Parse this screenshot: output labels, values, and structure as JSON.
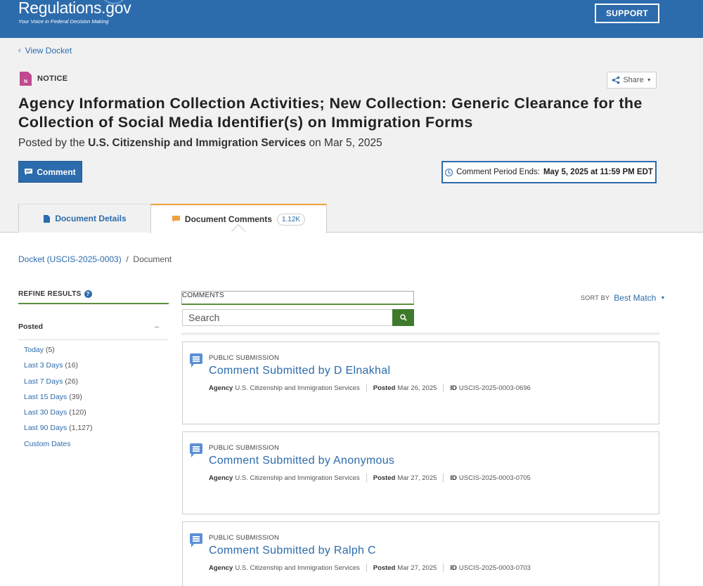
{
  "header": {
    "logo": "Regulations.gov",
    "tagline": "Your Voice in Federal Decision Making",
    "support_label": "SUPPORT"
  },
  "hero": {
    "back_link": "View Docket",
    "doc_type": "NOTICE",
    "doc_icon_letter": "N",
    "share_label": "Share",
    "title": "Agency Information Collection Activities; New Collection: Generic Clearance for the Collection of Social Media Identifier(s) on Immigration Forms",
    "posted_prefix": "Posted by the",
    "posted_agency": "U.S. Citizenship and Immigration Services",
    "posted_suffix": "on Mar 5, 2025",
    "comment_button": "Comment",
    "period_label": "Comment Period Ends:",
    "period_value": "May 5, 2025 at 11:59 PM EDT"
  },
  "tabs": {
    "details": "Document Details",
    "comments": "Document Comments",
    "comments_count": "1.12K"
  },
  "breadcrumb": {
    "docket": "Docket (USCIS-2025-0003)",
    "separator": "/",
    "current": "Document"
  },
  "sidebar": {
    "refine_label": "REFINE RESULTS",
    "posted_heading": "Posted",
    "collapse_symbol": "–",
    "filters": [
      {
        "label": "Today",
        "count": "(5)"
      },
      {
        "label": "Last 3 Days",
        "count": "(16)"
      },
      {
        "label": "Last 7 Days",
        "count": "(26)"
      },
      {
        "label": "Last 15 Days",
        "count": "(39)"
      },
      {
        "label": "Last 30 Days",
        "count": "(120)"
      },
      {
        "label": "Last 90 Days",
        "count": "(1,127)"
      },
      {
        "label": "Custom Dates",
        "count": ""
      }
    ]
  },
  "search": {
    "section_label": "COMMENTS",
    "placeholder": "Search",
    "sort_label": "SORT BY",
    "sort_value": "Best Match"
  },
  "results": [
    {
      "type": "PUBLIC SUBMISSION",
      "title": "Comment Submitted by D Elnakhal",
      "agency_label": "Agency",
      "agency": "U.S. Citizenship and Immigration Services",
      "posted_label": "Posted",
      "posted": "Mar 26, 2025",
      "id_label": "ID",
      "id": "USCIS-2025-0003-0696"
    },
    {
      "type": "PUBLIC SUBMISSION",
      "title": "Comment Submitted by Anonymous",
      "agency_label": "Agency",
      "agency": "U.S. Citizenship and Immigration Services",
      "posted_label": "Posted",
      "posted": "Mar 27, 2025",
      "id_label": "ID",
      "id": "USCIS-2025-0003-0705"
    },
    {
      "type": "PUBLIC SUBMISSION",
      "title": "Comment Submitted by Ralph C",
      "agency_label": "Agency",
      "agency": "U.S. Citizenship and Immigration Services",
      "posted_label": "Posted",
      "posted": "Mar 27, 2025",
      "id_label": "ID",
      "id": "USCIS-2025-0003-0703"
    }
  ],
  "icons": {
    "doc_type": "notice-document-icon",
    "share": "share-icon",
    "comment": "comment-icon",
    "clock": "clock-icon",
    "details_tab": "document-icon",
    "comments_tab": "comment-icon",
    "help": "help-icon",
    "search": "search-icon",
    "result": "comment-bubble-icon"
  },
  "colors": {
    "brand_blue": "#2c6bac",
    "accent_green": "#3d7a2b",
    "notice_magenta": "#c0498f",
    "tab_accent": "#f0a03c"
  }
}
